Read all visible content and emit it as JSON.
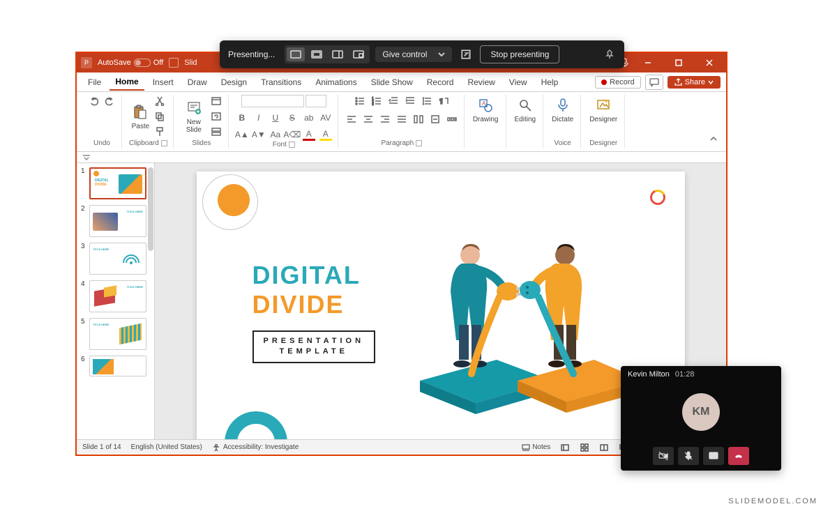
{
  "present_bar": {
    "status": "Presenting...",
    "give_control": "Give control",
    "stop": "Stop presenting"
  },
  "titlebar": {
    "autosave_label": "AutoSave",
    "autosave_state": "Off",
    "filename": "Slid"
  },
  "tabs": {
    "file": "File",
    "home": "Home",
    "insert": "Insert",
    "draw": "Draw",
    "design": "Design",
    "transitions": "Transitions",
    "animations": "Animations",
    "slideshow": "Slide Show",
    "record": "Record",
    "review": "Review",
    "view": "View",
    "help": "Help"
  },
  "ribbon_right": {
    "record": "Record",
    "share": "Share"
  },
  "groups": {
    "undo": "Undo",
    "clipboard": "Clipboard",
    "paste": "Paste",
    "slides": "Slides",
    "new_slide": "New Slide",
    "font": "Font",
    "paragraph": "Paragraph",
    "drawing": "Drawing",
    "editing": "Editing",
    "voice": "Voice",
    "dictate": "Dictate",
    "designer": "Designer",
    "designer_btn": "Designer"
  },
  "thumbs": {
    "n1": "1",
    "n2": "2",
    "n3": "3",
    "n4": "4",
    "n5": "5",
    "n6": "6"
  },
  "slide": {
    "title_l1": "DIGITAL",
    "title_l2": "DIVIDE",
    "subtitle_l1": "PRESENTATION",
    "subtitle_l2": "TEMPLATE"
  },
  "status": {
    "slide_index": "Slide 1 of 14",
    "language": "English (United States)",
    "accessibility": "Accessibility: Investigate",
    "notes": "Notes"
  },
  "call": {
    "name": "Kevin Milton",
    "timer": "01:28",
    "initials": "KM"
  },
  "watermark": "SLIDEMODEL.COM"
}
